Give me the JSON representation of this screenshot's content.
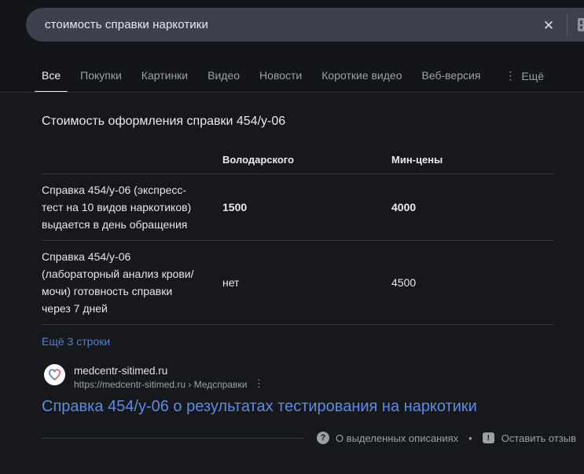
{
  "search": {
    "query": "стоимость справки наркотики",
    "clear_icon": "✕"
  },
  "tabs": {
    "items": [
      {
        "label": "Все",
        "active": true
      },
      {
        "label": "Покупки",
        "active": false
      },
      {
        "label": "Картинки",
        "active": false
      },
      {
        "label": "Видео",
        "active": false
      },
      {
        "label": "Новости",
        "active": false
      },
      {
        "label": "Короткие видео",
        "active": false
      },
      {
        "label": "Веб-версия",
        "active": false
      },
      {
        "label": "Ещё",
        "active": false
      }
    ],
    "more_dots_icon": "⋮"
  },
  "snippet": {
    "title": "Стоимость оформления справки 454/у-06",
    "more_rows_link": "Ещё 3 строки",
    "source": {
      "site_name": "medcentr-sitimed.ru",
      "breadcrumb": "https://medcentr-sitimed.ru › Медсправки",
      "menu_icon": "⋮"
    },
    "result_title": "Справка 454/у-06 о результатах тестирования на наркотики"
  },
  "table": {
    "columns": [
      "",
      "Володарского",
      "Мин-цены"
    ],
    "rows": [
      {
        "label": "Справка 454/у-06 (экспресс-тест на 10 видов наркотиков) выдается в день обращения",
        "values": [
          "1500",
          "4000"
        ]
      },
      {
        "label": "Справка 454/у-06 (лабораторный анализ крови/мочи) готовность справки через 7 дней",
        "values": [
          "нет",
          "4500"
        ]
      }
    ]
  },
  "footer": {
    "help_icon": "?",
    "about_snippets": "О выделенных описаниях",
    "separator_dot": "•",
    "feedback_icon": "!",
    "feedback": "Оставить отзыв"
  },
  "colors": {
    "page_background": "#17181c",
    "search_pill": "#3c414d",
    "link_blue": "#4d80da",
    "result_title_blue": "#5b8ce4",
    "secondary_text": "#9aa0a6",
    "favicon_blue": "#4a7fd0",
    "favicon_red": "#e05b5b"
  }
}
